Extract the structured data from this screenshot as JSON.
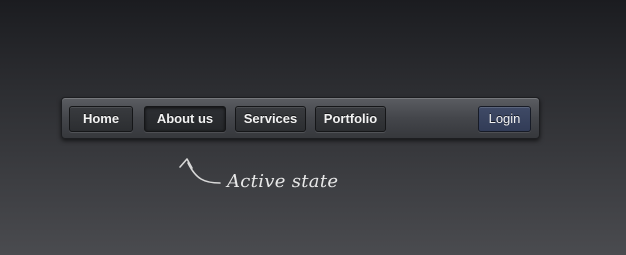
{
  "navbar": {
    "items": [
      {
        "label": "Home"
      },
      {
        "label": "About us",
        "active": true
      },
      {
        "label": "Services"
      },
      {
        "label": "Portfolio"
      }
    ],
    "login_label": "Login"
  },
  "annotation": {
    "text": "Active state"
  },
  "colors": {
    "background_top": "#1b1c20",
    "background_bottom": "#4a4b4f",
    "navbar": "#44464b",
    "button": "#2c2e31",
    "login_button": "#323c57",
    "text": "#f2f2f2"
  },
  "icons": {
    "annotation_arrow": "curved-arrow-icon"
  }
}
